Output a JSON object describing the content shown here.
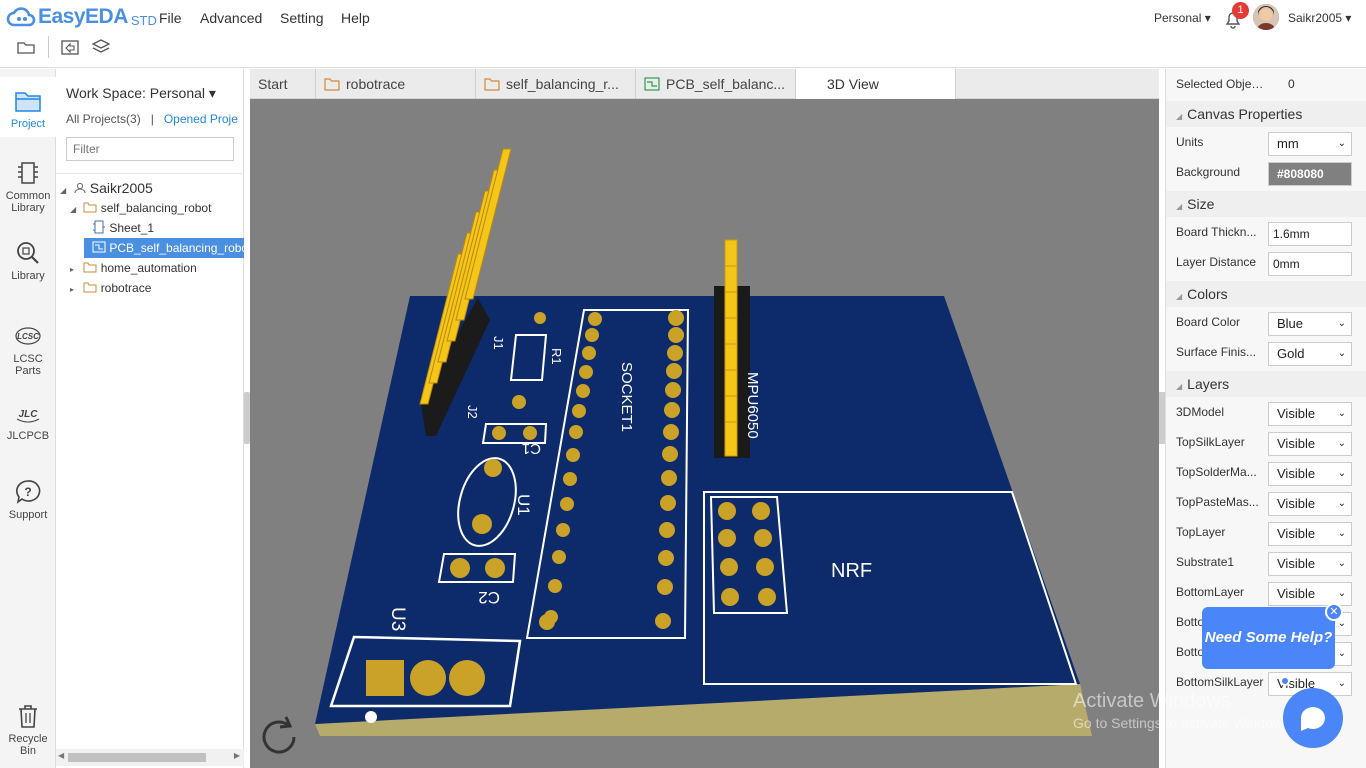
{
  "app": {
    "brand": "EasyEDA",
    "edition": "STD",
    "brand_color": "#4a90e2"
  },
  "menu": [
    "File",
    "Advanced",
    "Setting",
    "Help"
  ],
  "account": {
    "workspace_switch": "Personal",
    "notifications": "1",
    "username": "Saikr2005"
  },
  "toolbar_icons": [
    "folder-icon",
    "back-to-project-icon",
    "layers-icon"
  ],
  "leftnav": [
    {
      "label": "Project",
      "icon": "project-icon",
      "active": true
    },
    {
      "label": "Common Library",
      "icon": "common-library-icon"
    },
    {
      "label": "Library",
      "icon": "library-search-icon"
    },
    {
      "label": "LCSC Parts",
      "icon": "lcsc-icon"
    },
    {
      "label": "JLCPCB",
      "icon": "jlcpcb-icon"
    },
    {
      "label": "Support",
      "icon": "support-icon"
    },
    {
      "label": "Recycle Bin",
      "icon": "trash-icon"
    }
  ],
  "project_panel": {
    "workspace_label": "Work Space: Personal",
    "all_projects": "All Projects(3)",
    "separator": "|",
    "opened_projects": "Opened Proje",
    "filter_placeholder": "Filter",
    "tree": {
      "owner": "Saikr2005",
      "project1": "self_balancing_robot",
      "sheet": "Sheet_1",
      "pcb": "PCB_self_balancing_robot",
      "project2": "home_automation",
      "project3": "robotrace"
    }
  },
  "tabs": [
    {
      "label": "Start",
      "icon": ""
    },
    {
      "label": "robotrace",
      "icon": "folder-icon"
    },
    {
      "label": "self_balancing_r...",
      "icon": "folder-icon"
    },
    {
      "label": "PCB_self_balanc...",
      "icon": "pcb-icon"
    },
    {
      "label": "3D View",
      "icon": "",
      "active": true
    }
  ],
  "board": {
    "silk_labels": {
      "j1": "J1",
      "j2": "J2",
      "r1": "R1",
      "c1": "C1",
      "u1": "U1",
      "c2": "C2",
      "u3": "U3",
      "socket": "SOCKET1",
      "mpu": "MPU6050",
      "nrf": "NRF"
    },
    "board_color": "#0a2a6b",
    "pad_color": "#c9a227",
    "pin_color": "#f5c518"
  },
  "right_panel": {
    "selected_label": "Selected Objects",
    "selected_count": "0",
    "canvas_props": "Canvas Properties",
    "units_label": "Units",
    "units_value": "mm",
    "background_label": "Background",
    "background_value": "#808080",
    "size": "Size",
    "thickness_label": "Board Thickn...",
    "thickness_value": "1.6mm",
    "layerdist_label": "Layer Distance",
    "layerdist_value": "0mm",
    "colors": "Colors",
    "boardcolor_label": "Board Color",
    "boardcolor_value": "Blue",
    "finish_label": "Surface Finis...",
    "finish_value": "Gold",
    "layers": "Layers",
    "layer_rows": [
      {
        "name": "3DModel",
        "value": "Visible"
      },
      {
        "name": "TopSilkLayer",
        "value": "Visible"
      },
      {
        "name": "TopSolderMa...",
        "value": "Visible"
      },
      {
        "name": "TopPasteMas...",
        "value": "Visible"
      },
      {
        "name": "TopLayer",
        "value": "Visible"
      },
      {
        "name": "Substrate1",
        "value": "Visible"
      },
      {
        "name": "BottomLayer",
        "value": "Visible"
      },
      {
        "name": "Botto",
        "value": "Visible"
      },
      {
        "name": "Botto",
        "value": "Visible"
      },
      {
        "name": "BottomSilkLayer",
        "value": "Visible"
      }
    ]
  },
  "help": {
    "bubble": "Need Some Help?",
    "close": "✕"
  },
  "watermark": {
    "line1": "Activate Windows",
    "line2": "Go to Settings to activate Windows."
  }
}
